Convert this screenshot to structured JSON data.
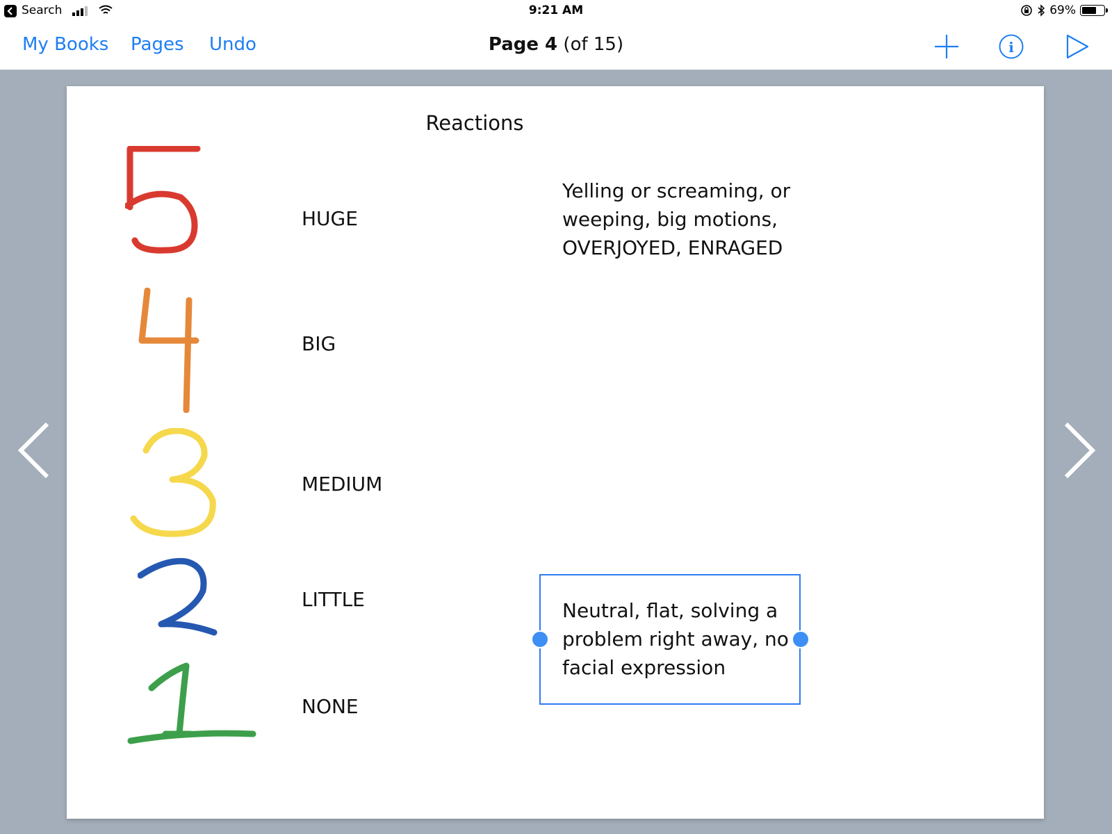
{
  "status_bar": {
    "back_app": "Search",
    "time": "9:21 AM",
    "battery": "69%",
    "battery_level": 0.69
  },
  "nav": {
    "my_books": "My Books",
    "pages": "Pages",
    "undo": "Undo",
    "page_label": "Page 4",
    "page_of": "(of 15)"
  },
  "icons": {
    "add": "plus-icon",
    "info": "info-icon",
    "play": "play-icon",
    "prev": "chevron-left-icon",
    "next": "chevron-right-icon"
  },
  "colors": {
    "accent": "#1e7ef3",
    "five": "#d93a2f",
    "four": "#e6883a",
    "three": "#f5d84c",
    "two": "#2559b1",
    "one": "#3d9f4b"
  },
  "page": {
    "title": "Reactions",
    "rows": [
      {
        "number": "5",
        "level": "HUGE"
      },
      {
        "number": "4",
        "level": "BIG"
      },
      {
        "number": "3",
        "level": "MEDIUM"
      },
      {
        "number": "2",
        "level": "LITTLE"
      },
      {
        "number": "1",
        "level": "NONE"
      }
    ],
    "descriptions": {
      "huge": [
        "Yelling or screaming, or",
        "weeping, big motions,",
        "OVERJOYED, ENRAGED"
      ],
      "little": [
        "Neutral, flat, solving a",
        "problem right away, no",
        "facial expression"
      ]
    }
  }
}
